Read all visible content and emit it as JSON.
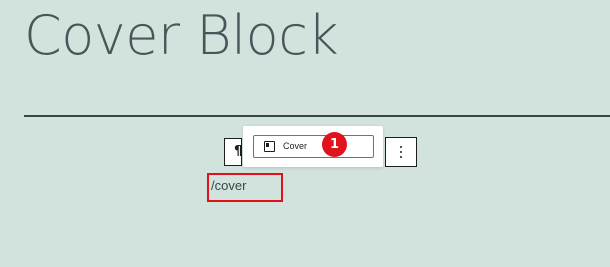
{
  "page": {
    "title": "Cover Block"
  },
  "editor": {
    "paragraph_icon": "¶",
    "typed_text": "/cover"
  },
  "autocomplete": {
    "option_label": "Cover",
    "option_icon": "cover-block-icon",
    "step_number": "1"
  },
  "toolbar": {
    "more_options_icon": "vertical-ellipsis-icon"
  },
  "colors": {
    "background": "#d2e3dd",
    "annotation": "#e0131c",
    "focus": "#3a7bd5"
  }
}
